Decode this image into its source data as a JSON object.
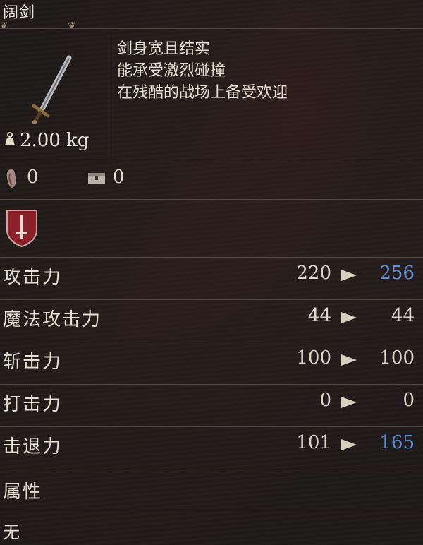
{
  "item": {
    "name": "阔剑",
    "weight": "2.00 kg",
    "description": [
      "剑身宽且结实",
      "能承受激烈碰撞",
      "在残酷的战场上备受欢迎"
    ]
  },
  "resources": [
    {
      "icon": "hand-print-icon",
      "value": "0"
    },
    {
      "icon": "chest-icon",
      "value": "0"
    }
  ],
  "category_icon": "sword-shield-icon",
  "stats": [
    {
      "label": "攻击力",
      "current": "220",
      "new": "256",
      "improved": true
    },
    {
      "label": "魔法攻击力",
      "current": "44",
      "new": "44",
      "improved": false
    },
    {
      "label": "斩击力",
      "current": "100",
      "new": "100",
      "improved": false
    },
    {
      "label": "打击力",
      "current": "0",
      "new": "0",
      "improved": false
    },
    {
      "label": "击退力",
      "current": "101",
      "new": "165",
      "improved": true
    }
  ],
  "attribute": {
    "label": "属性",
    "value": "无"
  },
  "colors": {
    "improved": "#5f8fd6",
    "text": "#e3dccd",
    "accent": "#8b1f2a"
  }
}
